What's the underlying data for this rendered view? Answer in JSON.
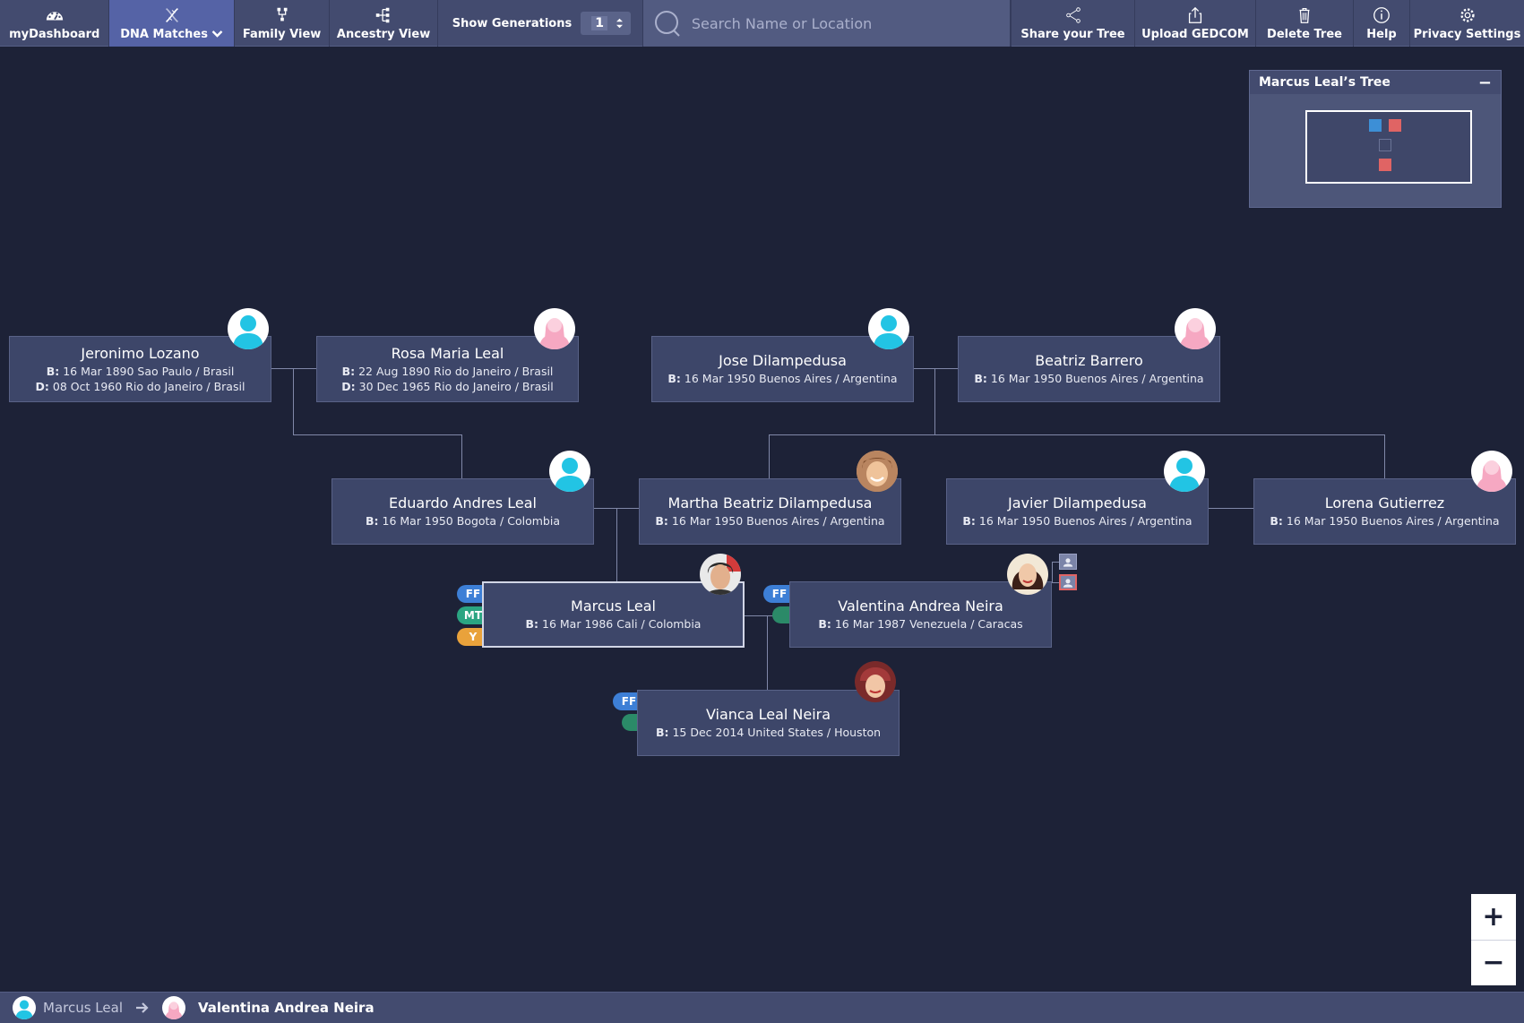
{
  "nav": {
    "dashboard": "myDashboard",
    "dna_matches": "DNA Matches",
    "family_view": "Family View",
    "ancestry_view": "Ancestry View",
    "show_generations_label": "Show Generations",
    "generations_value": "1",
    "search_placeholder": "Search Name or Location",
    "share": "Share your Tree",
    "upload": "Upload GEDCOM",
    "delete": "Delete Tree",
    "help": "Help",
    "privacy": "Privacy Settings"
  },
  "minimap": {
    "title": "Marcus Leal’s Tree",
    "collapse": "−"
  },
  "people": {
    "jeronimo": {
      "name": "Jeronimo Lozano",
      "birth": "16 Mar 1890 Sao Paulo / Brasil",
      "death": "08 Oct 1960 Rio do Janeiro / Brasil"
    },
    "rosa": {
      "name": "Rosa Maria Leal",
      "birth": "22 Aug 1890 Rio do Janeiro / Brasil",
      "death": "30 Dec 1965 Rio do Janeiro / Brasil"
    },
    "jose": {
      "name": "Jose Dilampedusa",
      "birth": "16 Mar 1950 Buenos Aires / Argentina"
    },
    "beatriz": {
      "name": "Beatriz Barrero",
      "birth": "16 Mar 1950 Buenos Aires / Argentina"
    },
    "eduardo": {
      "name": "Eduardo Andres Leal",
      "birth": "16 Mar 1950 Bogota / Colombia"
    },
    "martha": {
      "name": "Martha Beatriz Dilampedusa",
      "birth": "16 Mar 1950 Buenos Aires / Argentina"
    },
    "javier": {
      "name": "Javier Dilampedusa",
      "birth": "16 Mar 1950 Buenos Aires / Argentina"
    },
    "lorena": {
      "name": "Lorena Gutierrez",
      "birth": "16 Mar 1950 Buenos Aires / Argentina"
    },
    "marcus": {
      "name": "Marcus Leal",
      "birth": "16 Mar 1986 Cali / Colombia"
    },
    "valentina": {
      "name": "Valentina Andrea Neira",
      "birth": "16 Mar 1987 Venezuela / Caracas"
    },
    "vianca": {
      "name": "Vianca Leal Neira",
      "birth": "15 Dec 2014 United States / Houston"
    }
  },
  "labels": {
    "birth_prefix": "B:",
    "death_prefix": "D:"
  },
  "tags": {
    "ff": "FF",
    "mt": "MT",
    "y": "Y"
  },
  "zoom": {
    "in": "+",
    "out": "−"
  },
  "breadcrumb": {
    "from": "Marcus Leal",
    "to": "Valentina Andrea Neira"
  },
  "colors": {
    "male": "#22c4e4",
    "female": "#f6a8c2",
    "accent": "#5563a6",
    "background": "#1d2237"
  }
}
